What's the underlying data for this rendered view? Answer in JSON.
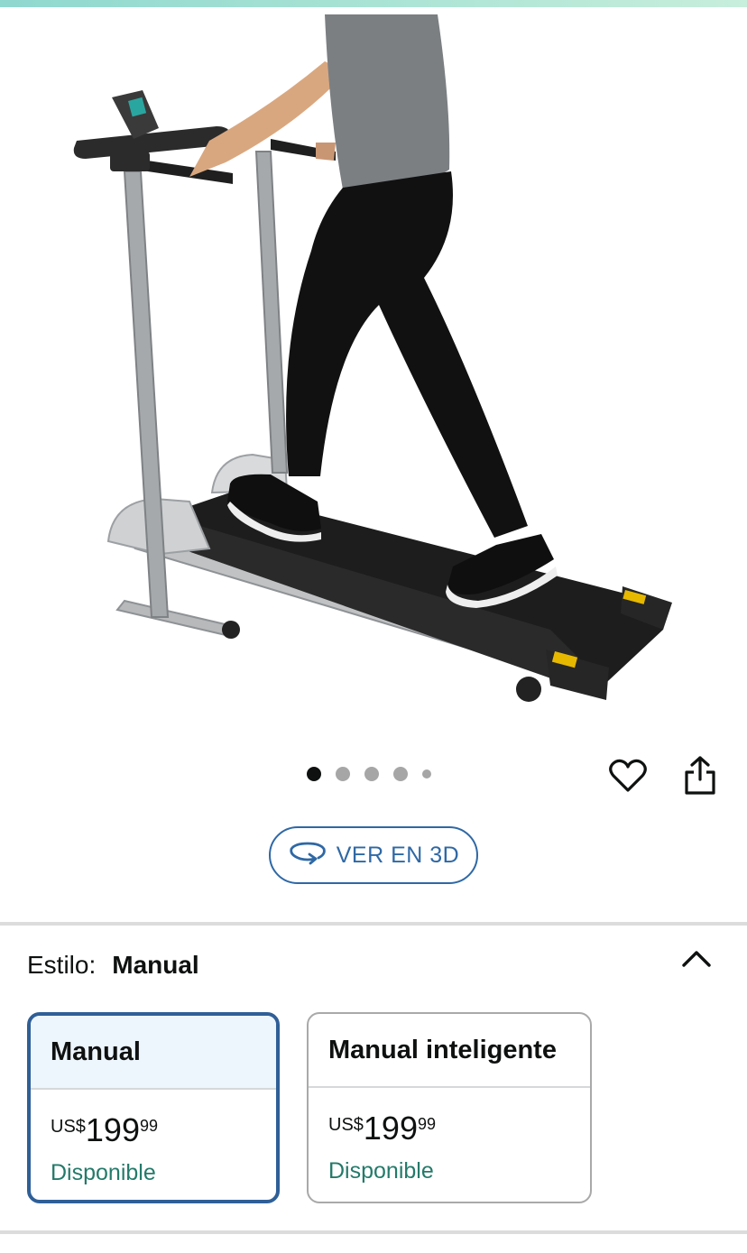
{
  "view3d": {
    "label": "VER EN 3D"
  },
  "carousel": {
    "total": 5,
    "active_index": 0
  },
  "style": {
    "label": "Estilo:",
    "selected": "Manual",
    "options": [
      {
        "name": "Manual",
        "currency": "US$",
        "whole": "199",
        "fraction": "99",
        "availability": "Disponible",
        "selected": true
      },
      {
        "name": "Manual inteligente",
        "currency": "US$",
        "whole": "199",
        "fraction": "99",
        "availability": "Disponible",
        "selected": false
      }
    ]
  },
  "icons": [
    "heart-icon",
    "share-icon",
    "rotate-3d-icon",
    "chevron-up-icon"
  ],
  "colors": {
    "accent_blue": "#2f68a5",
    "selected_border": "#2f5f97",
    "availability_green": "#247a6a"
  }
}
